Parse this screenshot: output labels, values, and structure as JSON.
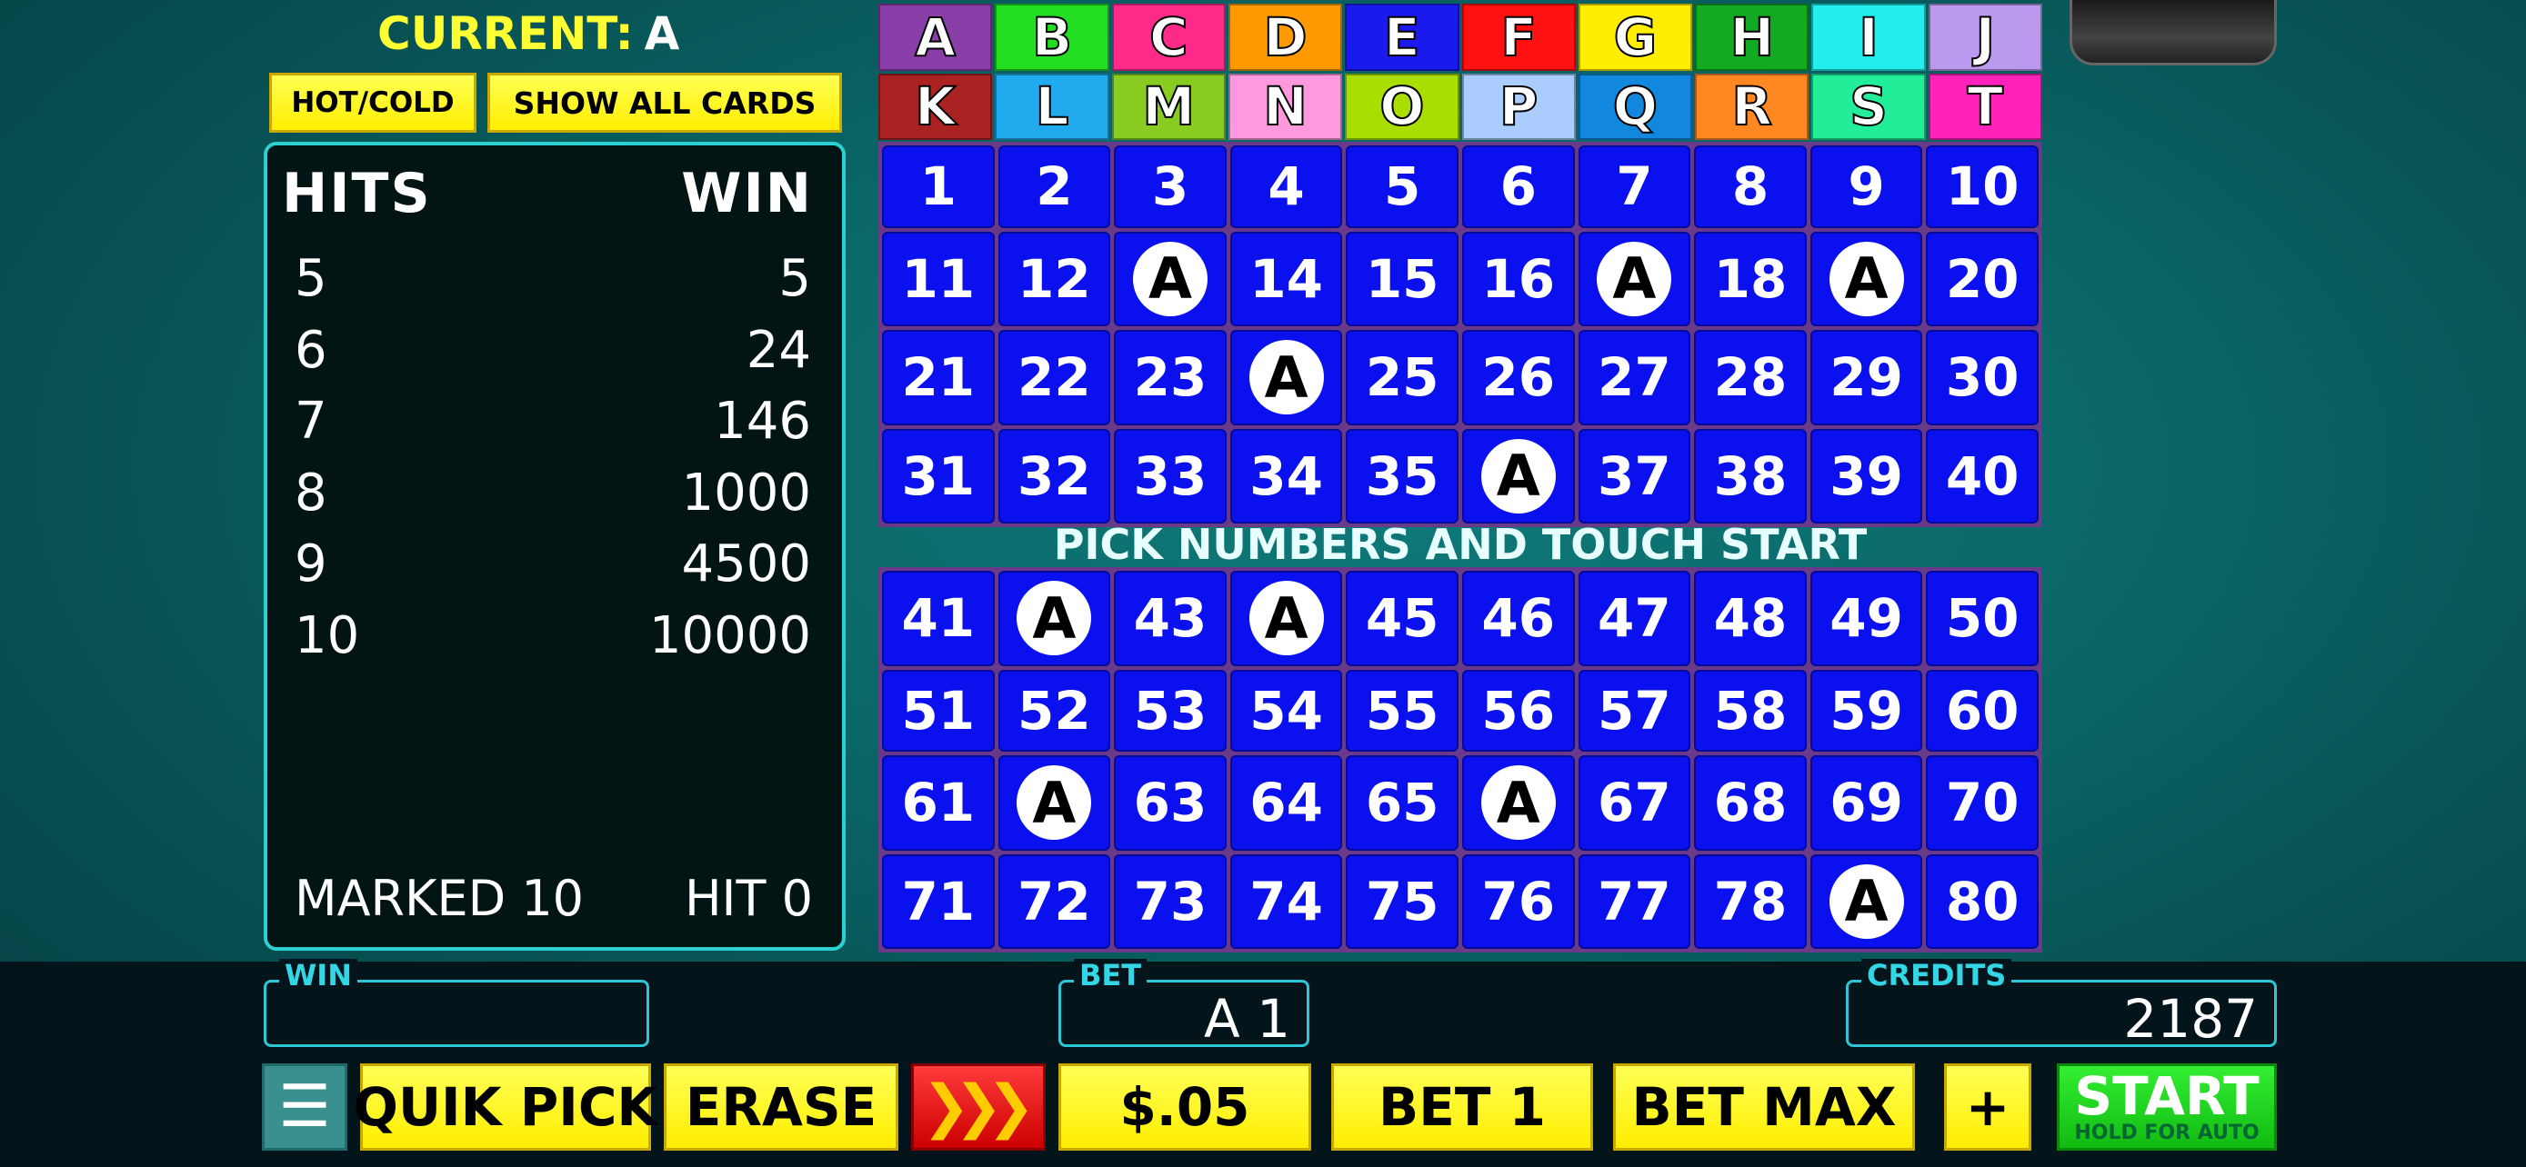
{
  "header": {
    "current_label": "CURRENT:",
    "current_value": "A",
    "hotcold_label": "HOT/COLD",
    "show_all_label": "SHOW ALL CARDS"
  },
  "paytable": {
    "hits_header": "HITS",
    "win_header": "WIN",
    "rows": [
      {
        "hits": "5",
        "win": "5"
      },
      {
        "hits": "6",
        "win": "24"
      },
      {
        "hits": "7",
        "win": "146"
      },
      {
        "hits": "8",
        "win": "1000"
      },
      {
        "hits": "9",
        "win": "4500"
      },
      {
        "hits": "10",
        "win": "10000"
      }
    ],
    "marked_text": "MARKED 10",
    "hit_text": "HIT 0"
  },
  "letters": [
    {
      "l": "A",
      "c": "#8a3fa8"
    },
    {
      "l": "B",
      "c": "#22dd22"
    },
    {
      "l": "C",
      "c": "#ff2a8a"
    },
    {
      "l": "D",
      "c": "#ff9900"
    },
    {
      "l": "E",
      "c": "#1a1aee"
    },
    {
      "l": "F",
      "c": "#ff1111"
    },
    {
      "l": "G",
      "c": "#ffee00"
    },
    {
      "l": "H",
      "c": "#11aa22"
    },
    {
      "l": "I",
      "c": "#22eeee"
    },
    {
      "l": "J",
      "c": "#bb99ee"
    },
    {
      "l": "K",
      "c": "#aa2222"
    },
    {
      "l": "L",
      "c": "#22aaee"
    },
    {
      "l": "M",
      "c": "#88cc22"
    },
    {
      "l": "N",
      "c": "#ff99dd"
    },
    {
      "l": "O",
      "c": "#aadd00"
    },
    {
      "l": "P",
      "c": "#aaccff"
    },
    {
      "l": "Q",
      "c": "#1188dd"
    },
    {
      "l": "R",
      "c": "#ff8822"
    },
    {
      "l": "S",
      "c": "#22ee99"
    },
    {
      "l": "T",
      "c": "#ff22bb"
    }
  ],
  "instruction": "PICK NUMBERS AND TOUCH START",
  "card_marker": "A",
  "marked_numbers": [
    13,
    17,
    19,
    24,
    36,
    42,
    44,
    62,
    66,
    79
  ],
  "board_top_numbers": [
    1,
    2,
    3,
    4,
    5,
    6,
    7,
    8,
    9,
    10,
    11,
    12,
    13,
    14,
    15,
    16,
    17,
    18,
    19,
    20,
    21,
    22,
    23,
    24,
    25,
    26,
    27,
    28,
    29,
    30,
    31,
    32,
    33,
    34,
    35,
    36,
    37,
    38,
    39,
    40
  ],
  "board_bottom_numbers": [
    41,
    42,
    43,
    44,
    45,
    46,
    47,
    48,
    49,
    50,
    51,
    52,
    53,
    54,
    55,
    56,
    57,
    58,
    59,
    60,
    61,
    62,
    63,
    64,
    65,
    66,
    67,
    68,
    69,
    70,
    71,
    72,
    73,
    74,
    75,
    76,
    77,
    78,
    79,
    80
  ],
  "fields": {
    "win_label": "WIN",
    "win_value": "",
    "bet_label": "BET",
    "bet_value": "A 1",
    "credits_label": "CREDITS",
    "credits_value": "2187"
  },
  "buttons": {
    "menu_icon": "☰",
    "quikpick": "QUIK PICK",
    "erase": "ERASE",
    "speed_icon": "❯❯❯",
    "denom": "$.05",
    "bet1": "BET 1",
    "betmax": "BET MAX",
    "plus": "+",
    "start": "START",
    "start_sub": "HOLD FOR AUTO"
  }
}
